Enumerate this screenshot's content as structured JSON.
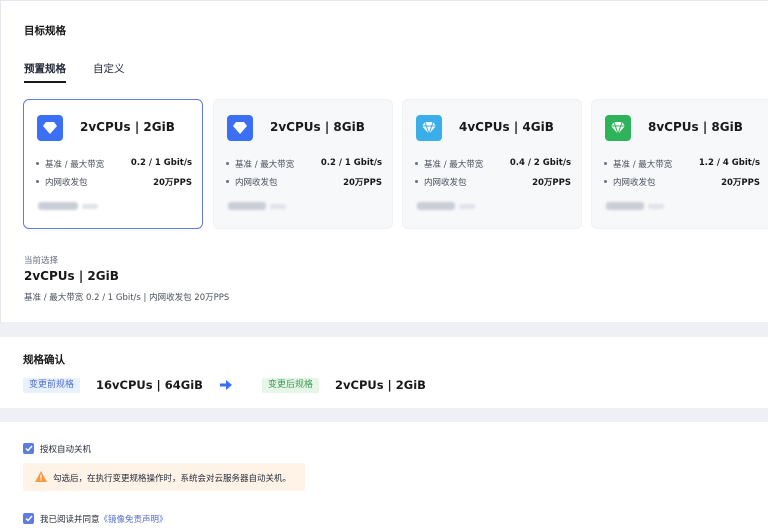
{
  "target_spec": {
    "title": "目标规格",
    "tabs": [
      {
        "label": "预置规格",
        "active": true
      },
      {
        "label": "自定义",
        "active": false
      }
    ],
    "cards": [
      {
        "title": "2vCPUs | 2GiB",
        "icon": "diamond-icon",
        "icon_color": "#3b6ff5",
        "selected": true,
        "rows": [
          {
            "label": "基准 / 最大带宽",
            "value": "0.2 / 1 Gbit/s"
          },
          {
            "label": "内网收发包",
            "value": "20万PPS"
          }
        ]
      },
      {
        "title": "2vCPUs | 8GiB",
        "icon": "diamond-icon",
        "icon_color": "#3b6ff5",
        "selected": false,
        "rows": [
          {
            "label": "基准 / 最大带宽",
            "value": "0.2 / 1 Gbit/s"
          },
          {
            "label": "内网收发包",
            "value": "20万PPS"
          }
        ]
      },
      {
        "title": "4vCPUs | 4GiB",
        "icon": "gem-icon",
        "icon_color": "#3aaee8",
        "selected": false,
        "rows": [
          {
            "label": "基准 / 最大带宽",
            "value": "0.4 / 2 Gbit/s"
          },
          {
            "label": "内网收发包",
            "value": "20万PPS"
          }
        ]
      },
      {
        "title": "8vCPUs | 8GiB",
        "icon": "gem-icon",
        "icon_color": "#2fb35a",
        "selected": false,
        "rows": [
          {
            "label": "基准 / 最大带宽",
            "value": "1.2 / 4 Gbit/s"
          },
          {
            "label": "内网收发包",
            "value": "20万PPS"
          }
        ]
      }
    ],
    "current": {
      "label": "当前选择",
      "value": "2vCPUs | 2GiB",
      "desc": "基准 / 最大带宽  0.2 / 1 Gbit/s  |  内网收发包  20万PPS"
    }
  },
  "confirm": {
    "title": "规格确认",
    "before_tag": "变更前规格",
    "before_value": "16vCPUs | 64GiB",
    "after_tag": "变更后规格",
    "after_value": "2vCPUs | 2GiB"
  },
  "options": {
    "auto_shutdown_label": "授权自动关机",
    "auto_shutdown_checked": true,
    "warning_text": "勾选后，在执行变更规格操作时，系统会对云服务器自动关机。",
    "agree_prefix": "我已阅读并同意",
    "agree_link": "《镜像免责声明》",
    "agree_checked": true
  },
  "colors": {
    "primary": "#5e7ce0",
    "warning": "#fa9841",
    "green_tag": "#3f9b52"
  }
}
